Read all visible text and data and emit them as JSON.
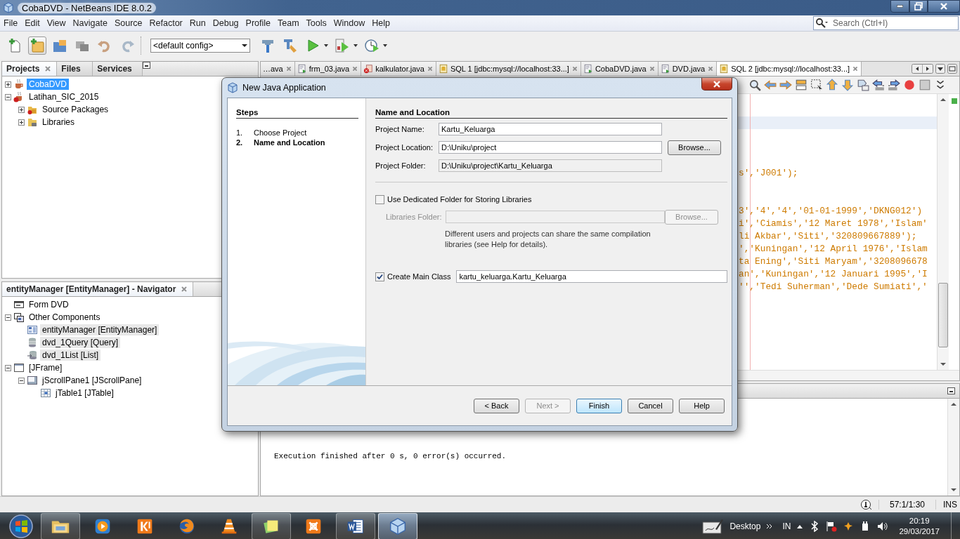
{
  "window": {
    "title": "CobaDVD - NetBeans IDE 8.0.2"
  },
  "menu": [
    "File",
    "Edit",
    "View",
    "Navigate",
    "Source",
    "Refactor",
    "Run",
    "Debug",
    "Profile",
    "Team",
    "Tools",
    "Window",
    "Help"
  ],
  "search": {
    "placeholder": "Search (Ctrl+I)"
  },
  "toolbar": {
    "config": "<default config>"
  },
  "projects_panel": {
    "tabs": [
      {
        "label": "Projects",
        "selected": true
      },
      {
        "label": "Files",
        "selected": false
      },
      {
        "label": "Services",
        "selected": false
      }
    ],
    "tree": [
      {
        "label": "CobaDVD",
        "kind": "project",
        "expanded": false,
        "selected": true
      },
      {
        "label": "Latihan_SIC_2015",
        "kind": "project_error",
        "expanded": true,
        "selected": false,
        "children": [
          {
            "label": "Source Packages",
            "kind": "packages",
            "expanded": false,
            "selected": false
          },
          {
            "label": "Libraries",
            "kind": "libraries",
            "expanded": false,
            "selected": false
          }
        ]
      }
    ]
  },
  "navigator": {
    "title": "entityManager [EntityManager] - Navigator",
    "tree": [
      {
        "label": "Form DVD",
        "kind": "form"
      },
      {
        "label": "Other Components",
        "kind": "components",
        "expanded": true,
        "children": [
          {
            "label": "entityManager [EntityManager]",
            "kind": "entity",
            "highlighted": true
          },
          {
            "label": "dvd_1Query [Query]",
            "kind": "query",
            "highlighted": true
          },
          {
            "label": "dvd_1List [List]",
            "kind": "list",
            "highlighted": true
          }
        ]
      },
      {
        "label": "[JFrame]",
        "kind": "frame",
        "expanded": true,
        "children": [
          {
            "label": "jScrollPane1 [JScrollPane]",
            "kind": "scroll",
            "expanded": true,
            "children": [
              {
                "label": "jTable1 [JTable]",
                "kind": "table"
              }
            ]
          }
        ]
      }
    ]
  },
  "editor": {
    "tabs": [
      {
        "label": "…ava",
        "kind": "none",
        "selected": false
      },
      {
        "label": "frm_03.java",
        "kind": "form",
        "selected": false
      },
      {
        "label": "kalkulator.java",
        "kind": "error",
        "selected": false
      },
      {
        "label": "SQL 1 [jdbc:mysql://localhost:33...]",
        "kind": "sql",
        "selected": false
      },
      {
        "label": "CobaDVD.java",
        "kind": "form",
        "selected": false
      },
      {
        "label": "DVD.java",
        "kind": "form",
        "selected": false
      },
      {
        "label": "SQL 2 [jdbc:mysql://localhost:33...]",
        "kind": "sql",
        "selected": true
      }
    ],
    "code_lines": [
      "s','J001');",
      "3','4','4','01-01-1999','DKNG012')",
      "i','Ciamis','12 Maret 1978','Islam'",
      "li Akbar','Siti','320809667889');",
      "','Kuningan','12 April 1976','Islam",
      "ta Ening','Siti Maryam','3208096678",
      "an','Kuningan','12 Januari 1995','I",
      "'','Tedi Suherman','Dede Sumiati','"
    ]
  },
  "output": {
    "lines": [
      "Execution finished after 0 s, 0 error(s) occurred."
    ]
  },
  "status_bar": {
    "position": "57:1/1:30",
    "mode": "INS"
  },
  "dialog": {
    "title": "New Java Application",
    "steps_heading": "Steps",
    "steps": [
      {
        "number": "1.",
        "label": "Choose Project",
        "selected": false
      },
      {
        "number": "2.",
        "label": "Name and Location",
        "selected": true
      }
    ],
    "heading": "Name and Location",
    "fields": [
      {
        "label": "Project Name:",
        "value": "Kartu_Keluarga",
        "kind": "editable"
      },
      {
        "label": "Project Location:",
        "value": "D:\\Uniku\\project",
        "kind": "editable",
        "button": "Browse..."
      },
      {
        "label": "Project Folder:",
        "value": "D:\\Uniku\\project\\Kartu_Keluarga",
        "kind": "readonly"
      }
    ],
    "dedicated_folder": {
      "label": "Use Dedicated Folder for Storing Libraries",
      "checked": false
    },
    "libraries_folder": {
      "label": "Libraries Folder:",
      "button": "Browse...",
      "disabled": true
    },
    "note": "Different users and projects can share the same compilation libraries (see Help for details).",
    "main_class": {
      "label": "Create Main Class",
      "checked": true,
      "value": "kartu_keluarga.Kartu_Keluarga"
    },
    "buttons": [
      {
        "label": "< Back",
        "disabled": false,
        "default": false
      },
      {
        "label": "Next >",
        "disabled": true,
        "default": false
      },
      {
        "label": "Finish",
        "disabled": false,
        "default": true
      },
      {
        "label": "Cancel",
        "disabled": false,
        "default": false
      },
      {
        "label": "Help",
        "disabled": false,
        "default": false
      }
    ]
  },
  "taskbar": {
    "apps": [
      {
        "kind": "explorer",
        "running": true,
        "selected": false
      },
      {
        "kind": "media",
        "running": false,
        "selected": false
      },
      {
        "kind": "kapp",
        "running": false,
        "selected": false
      },
      {
        "kind": "firefox",
        "running": false,
        "selected": false
      },
      {
        "kind": "vlc",
        "running": false,
        "selected": false
      },
      {
        "kind": "notes",
        "running": true,
        "selected": false
      },
      {
        "kind": "xampp",
        "running": false,
        "selected": false
      },
      {
        "kind": "word",
        "running": true,
        "selected": false
      },
      {
        "kind": "netbeans",
        "running": true,
        "selected": true
      }
    ],
    "desktop": "Desktop",
    "language": "IN",
    "time": "20:19",
    "date": "29/03/2017"
  }
}
